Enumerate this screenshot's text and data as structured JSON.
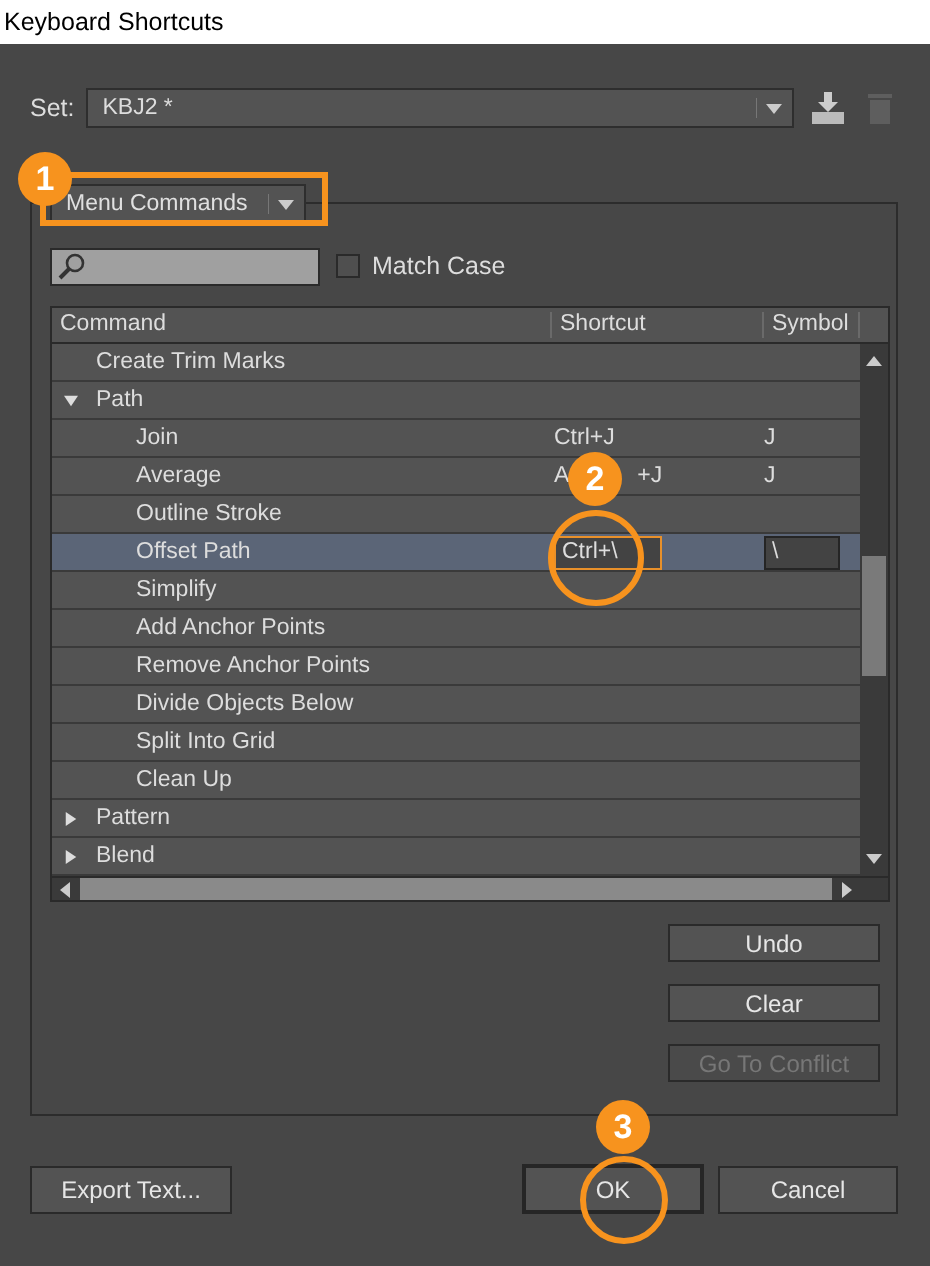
{
  "window": {
    "title": "Keyboard Shortcuts"
  },
  "set": {
    "label": "Set:",
    "value": "KBJ2 *"
  },
  "category": {
    "value": "Menu Commands"
  },
  "match_case": {
    "label": "Match Case",
    "checked": false
  },
  "table": {
    "columns": [
      "Command",
      "Shortcut",
      "Symbol"
    ],
    "rows": [
      {
        "kind": "command",
        "command": "Create Trim Marks",
        "selected": false
      },
      {
        "kind": "group",
        "command": "Path",
        "expanded": true,
        "selected": false,
        "children": [
          {
            "kind": "command",
            "command": "Join",
            "shortcut": "Ctrl+J",
            "symbol": "J",
            "selected": false
          },
          {
            "kind": "command",
            "command": "Average",
            "shortcut": "A",
            "shortcut_end": "+J",
            "symbol": "J",
            "selected": false
          },
          {
            "kind": "command",
            "command": "Outline Stroke",
            "selected": false
          },
          {
            "kind": "command",
            "command": "Offset Path",
            "shortcut": "Ctrl+\\",
            "symbol": "\\",
            "selected": true
          },
          {
            "kind": "command",
            "command": "Simplify",
            "selected": false
          },
          {
            "kind": "command",
            "command": "Add Anchor Points",
            "selected": false
          },
          {
            "kind": "command",
            "command": "Remove Anchor Points",
            "selected": false
          },
          {
            "kind": "command",
            "command": "Divide Objects Below",
            "selected": false
          },
          {
            "kind": "command",
            "command": "Split Into Grid",
            "selected": false
          },
          {
            "kind": "command",
            "command": "Clean Up",
            "selected": false
          }
        ]
      },
      {
        "kind": "group",
        "command": "Pattern",
        "expanded": false,
        "selected": false
      },
      {
        "kind": "group",
        "command": "Blend",
        "expanded": false,
        "selected": false
      }
    ]
  },
  "side_buttons": [
    {
      "label": "Undo",
      "disabled": false
    },
    {
      "label": "Clear",
      "disabled": false
    },
    {
      "label": "Go To Conflict",
      "disabled": true
    }
  ],
  "footer": {
    "export": "Export Text...",
    "ok": "OK",
    "cancel": "Cancel"
  },
  "callouts": [
    "1",
    "2",
    "3"
  ]
}
